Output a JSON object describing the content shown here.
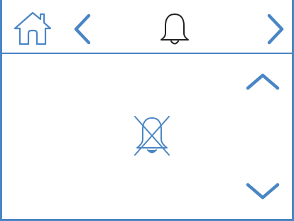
{
  "colors": {
    "accent": "#4a86c5",
    "icon_dark": "#222222",
    "background": "#ffffff"
  },
  "header": {
    "home_icon": "home-icon",
    "prev_icon": "chevron-left-icon",
    "title_icon": "bell-icon",
    "next_icon": "chevron-right-icon"
  },
  "main": {
    "status_icon": "bell-off-icon",
    "up_icon": "chevron-up-icon",
    "down_icon": "chevron-down-icon"
  }
}
